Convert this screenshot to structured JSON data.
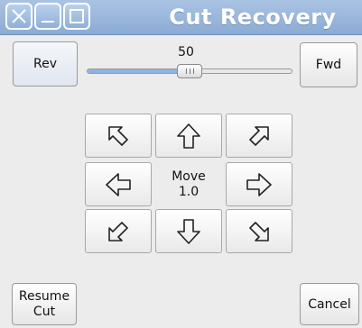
{
  "window": {
    "title": "Cut Recovery",
    "controls": [
      "close-icon",
      "minimize-icon",
      "maximize-icon"
    ]
  },
  "toolbar": {
    "rev_label": "Rev",
    "fwd_label": "Fwd"
  },
  "slider": {
    "value": 50,
    "value_text": "50",
    "min": 0,
    "max": 100,
    "accent": "#8fb3de"
  },
  "jog": {
    "center_line1": "Move",
    "center_line2": "1.0",
    "buttons": [
      {
        "name": "jog-up-left-button",
        "icon": "arrow-up-left-icon"
      },
      {
        "name": "jog-up-button",
        "icon": "arrow-up-icon"
      },
      {
        "name": "jog-up-right-button",
        "icon": "arrow-up-right-icon"
      },
      {
        "name": "jog-left-button",
        "icon": "arrow-left-icon"
      },
      {
        "name": "jog-right-button",
        "icon": "arrow-right-icon"
      },
      {
        "name": "jog-down-left-button",
        "icon": "arrow-down-left-icon"
      },
      {
        "name": "jog-down-button",
        "icon": "arrow-down-icon"
      },
      {
        "name": "jog-down-right-button",
        "icon": "arrow-down-right-icon"
      }
    ]
  },
  "footer": {
    "resume_line1": "Resume",
    "resume_line2": "Cut",
    "cancel_label": "Cancel"
  }
}
